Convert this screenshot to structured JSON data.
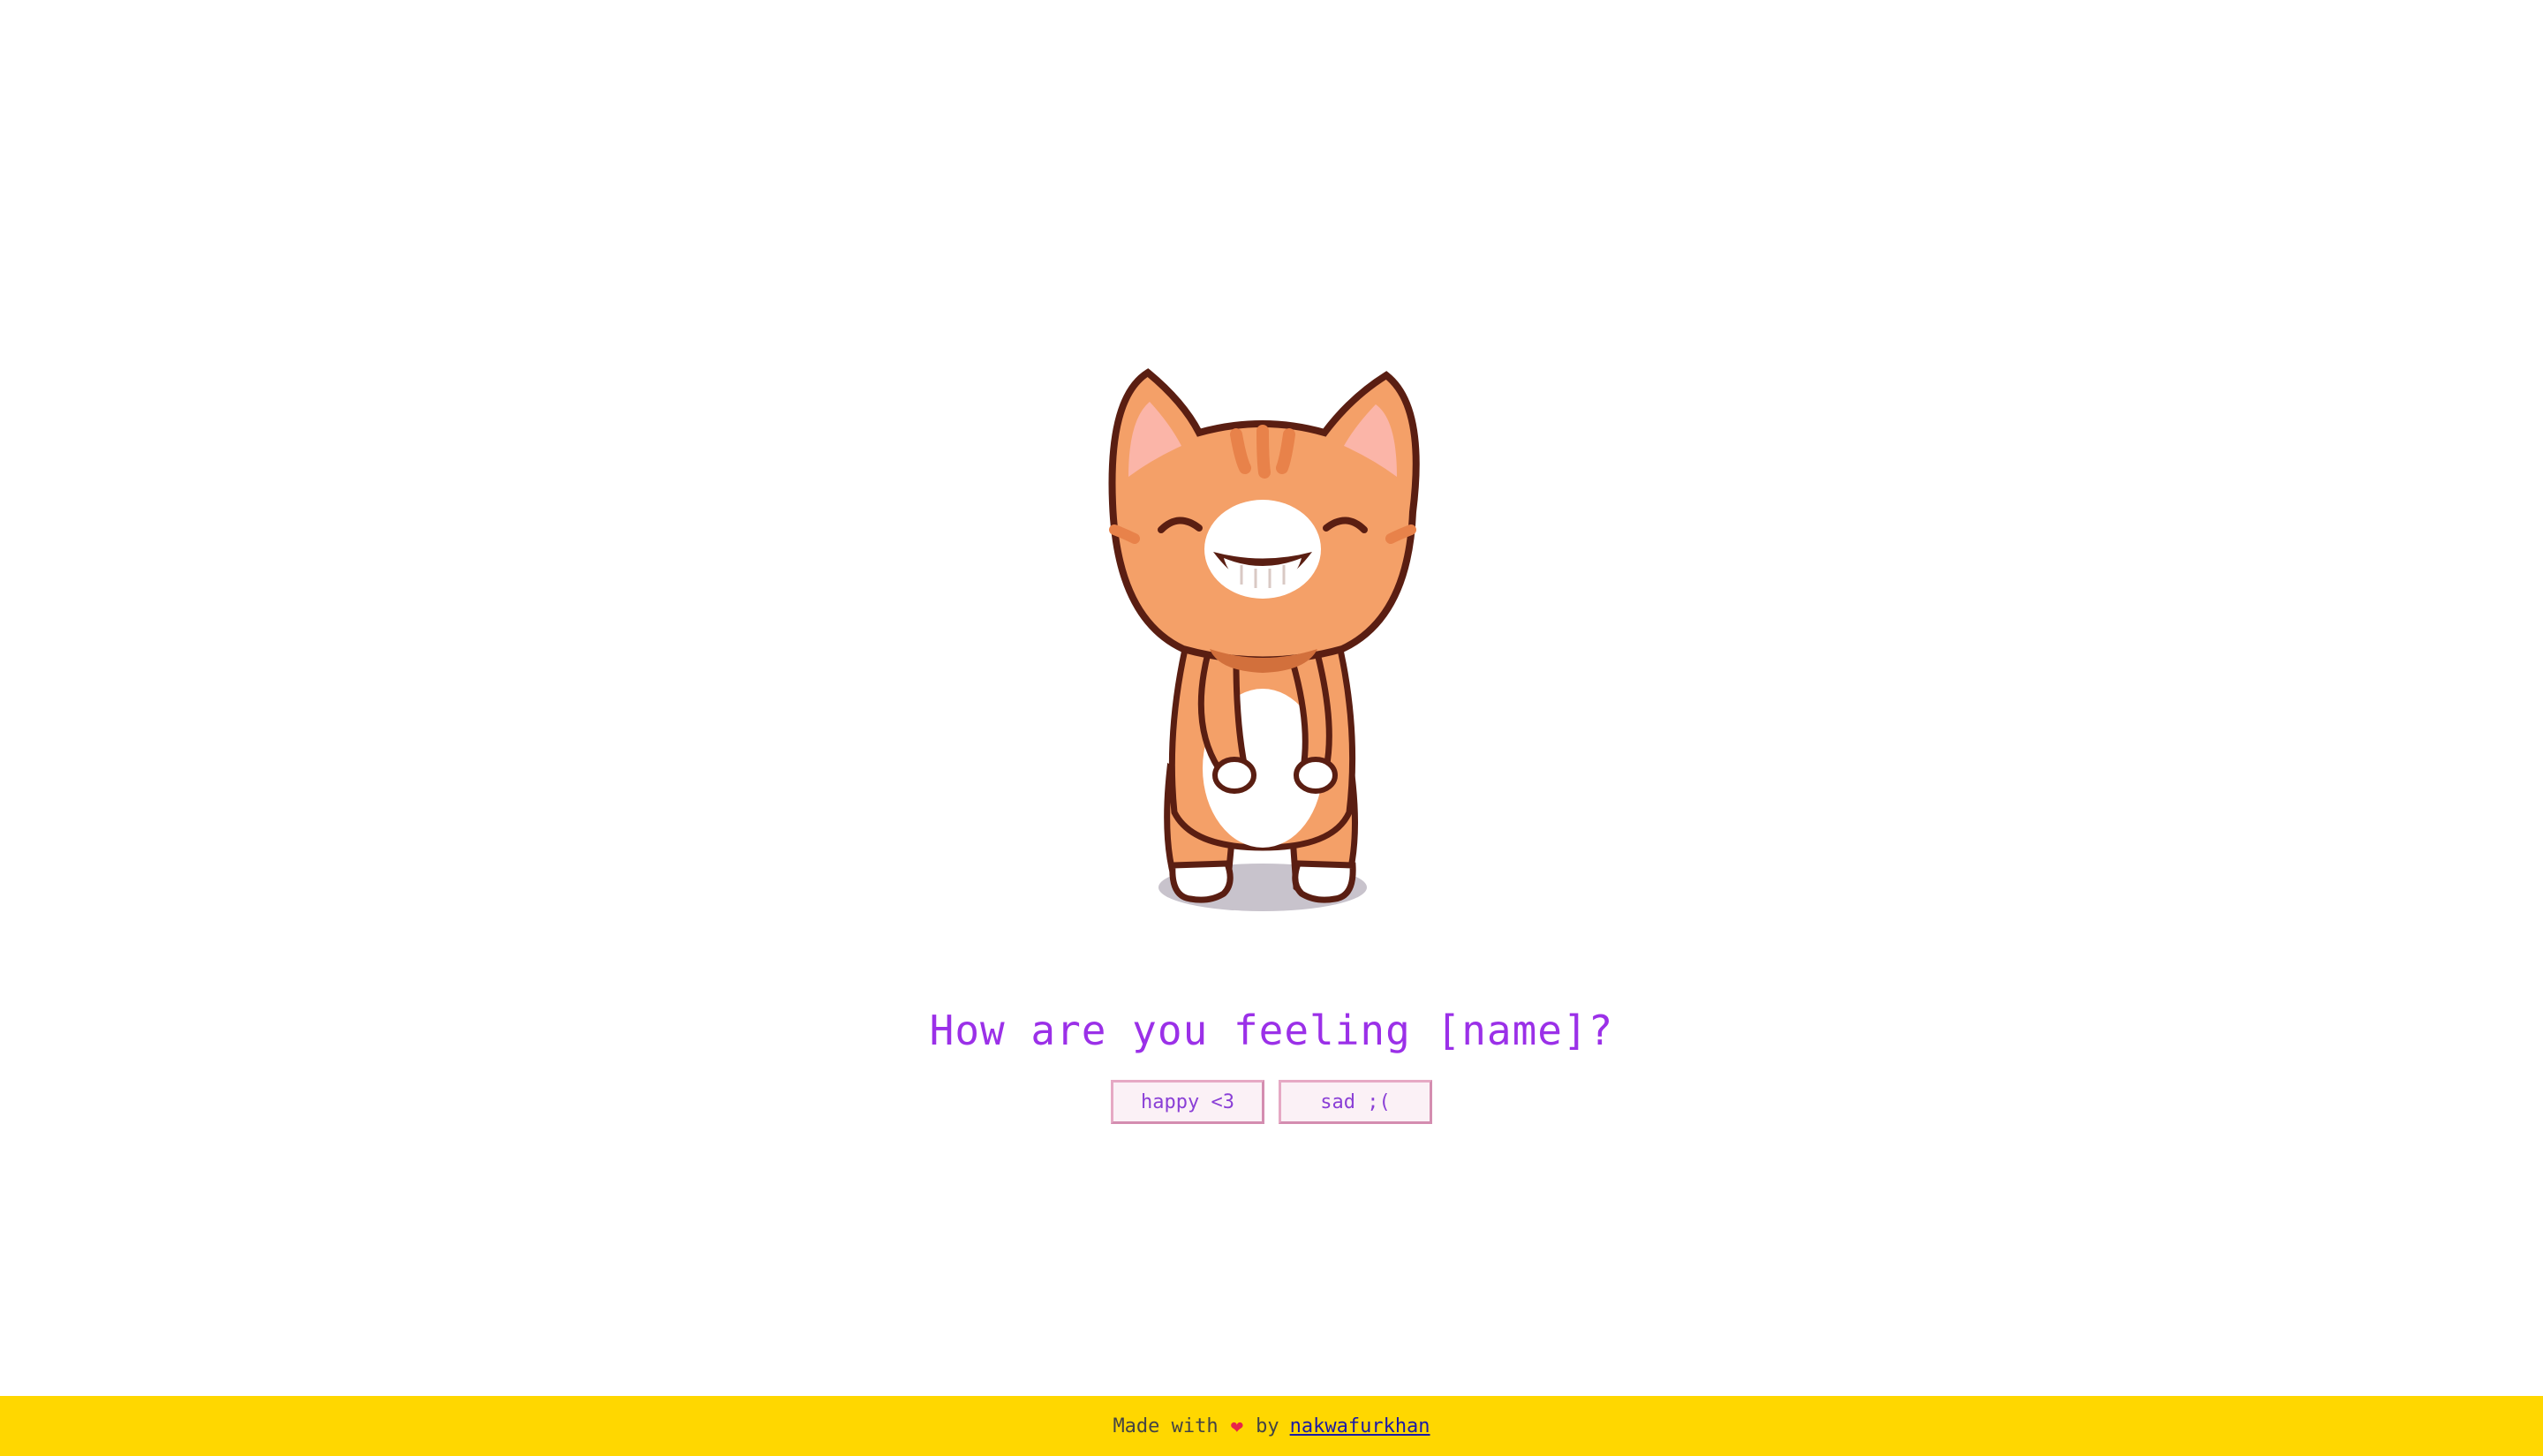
{
  "question": "How are you feeling [name]?",
  "buttons": {
    "happy": "happy <3",
    "sad": "sad ;("
  },
  "footer": {
    "made_with": "Made with",
    "heart_icon": "heart-icon",
    "by": "by",
    "author_link": "nakwafurkhan"
  },
  "colors": {
    "question": "#9b30e8",
    "footer_bg": "#ffd700",
    "cat_orange": "#f4a068",
    "outline": "#5a1e12"
  }
}
